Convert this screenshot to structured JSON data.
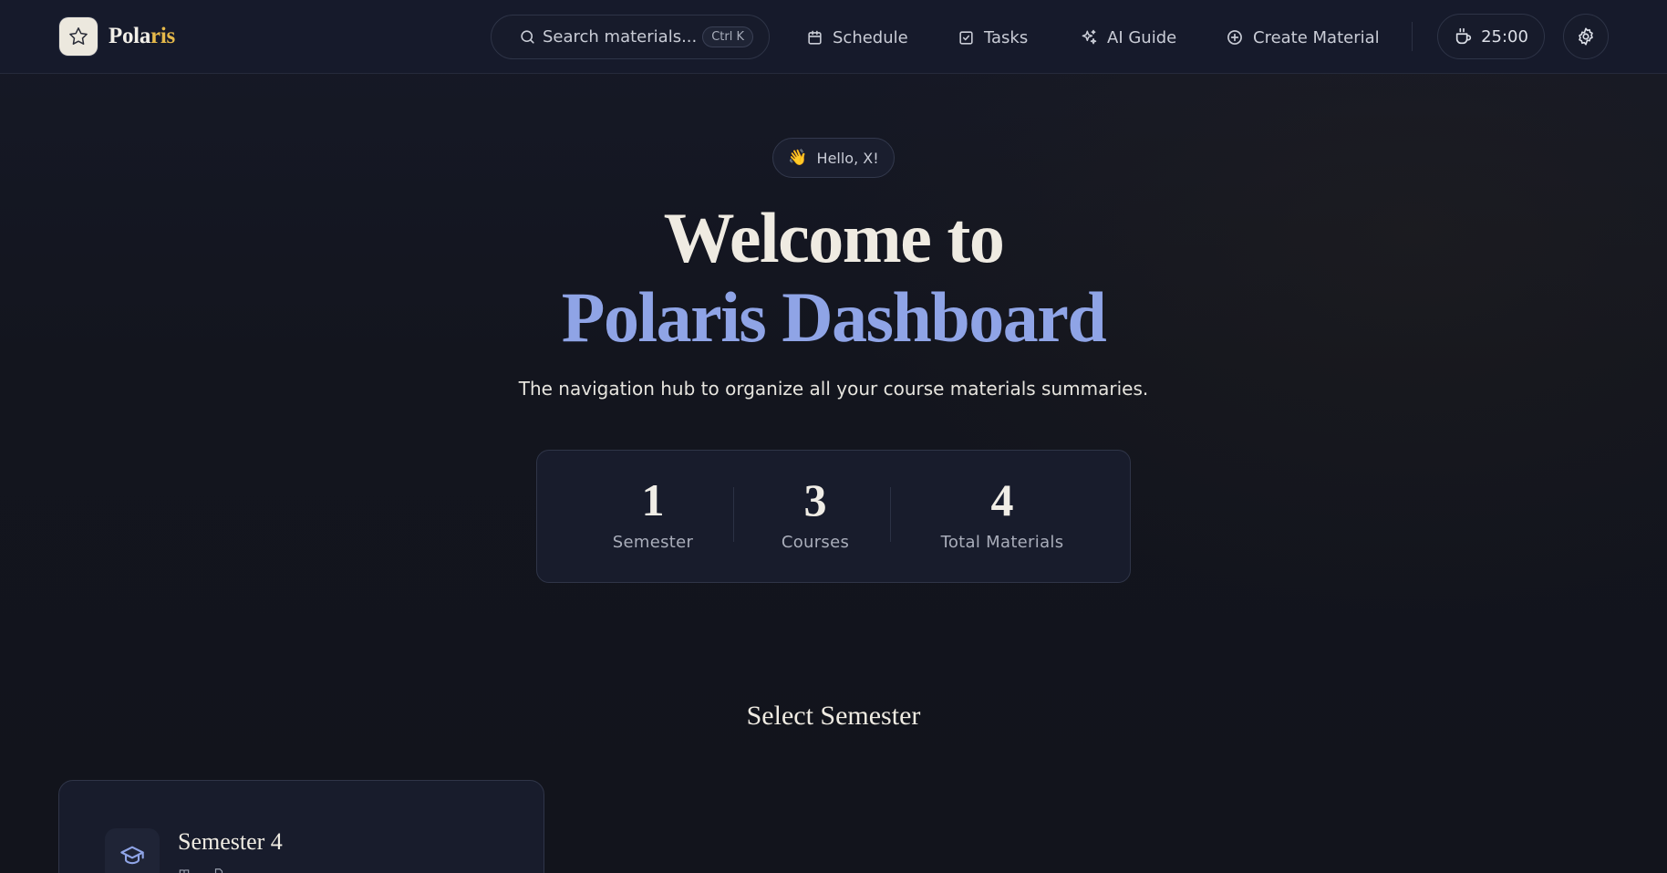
{
  "brand": {
    "name_main": "Pola",
    "name_accent": "ris",
    "logo_icon": "star-icon",
    "accent_color": "#e6b94a"
  },
  "nav": {
    "search_placeholder": "Search materials...",
    "search_shortcut": "Ctrl K",
    "items": [
      {
        "label": "Schedule",
        "icon": "calendar-icon"
      },
      {
        "label": "Tasks",
        "icon": "checkbox-icon"
      },
      {
        "label": "AI Guide",
        "icon": "sparkles-icon"
      },
      {
        "label": "Create Material",
        "icon": "plus-circle-icon"
      }
    ],
    "timer": "25:00",
    "timer_icon": "coffee-icon",
    "settings_icon": "gear-icon"
  },
  "hero": {
    "greeting_emoji": "👋",
    "greeting": "Hello, X!",
    "title_line1": "Welcome to",
    "title_line2": "Polaris Dashboard",
    "title_accent_color": "#8fa4e6",
    "subtitle": "The navigation hub to organize all your course materials summaries."
  },
  "stats": [
    {
      "value": "1",
      "label": "Semester"
    },
    {
      "value": "3",
      "label": "Courses"
    },
    {
      "value": "4",
      "label": "Total Materials"
    }
  ],
  "semesters": {
    "section_title": "Select Semester",
    "cards": [
      {
        "name": "Semester 4",
        "icon": "graduation-cap-icon"
      }
    ]
  }
}
